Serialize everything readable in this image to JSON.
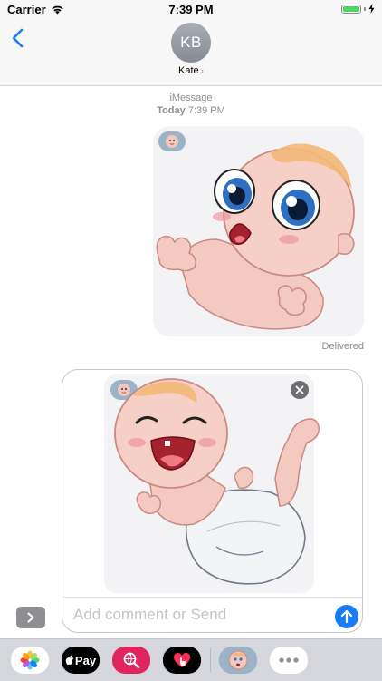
{
  "status_bar": {
    "carrier": "Carrier",
    "time": "7:39 PM",
    "battery_level": 1.0,
    "battery_color": "#4cd964"
  },
  "nav": {
    "back_icon": "chevron-left-icon",
    "accent_color": "#1a7cf5",
    "avatar_initials": "KB",
    "contact_name": "Kate",
    "contact_chevron": "›"
  },
  "conversation": {
    "service": "iMessage",
    "timestamp_day": "Today",
    "timestamp_time": "7:39 PM",
    "messages": [
      {
        "type": "sticker",
        "sticker": "crying-baby-sticker",
        "status": "Delivered"
      }
    ]
  },
  "compose": {
    "attachment_sticker": "laughing-baby-sticker",
    "remove_icon": "close-icon",
    "placeholder": "Add comment or Send",
    "value": "",
    "send_icon": "arrow-up-icon",
    "expand_icon": "chevron-right-icon"
  },
  "app_drawer": {
    "apps": [
      {
        "name": "photos-app-icon"
      },
      {
        "name": "apple-pay-app-icon",
        "label": "Pay"
      },
      {
        "name": "images-search-app-icon"
      },
      {
        "name": "digital-touch-app-icon"
      },
      {
        "name": "baby-sticker-app-icon"
      },
      {
        "name": "more-apps-icon"
      }
    ]
  }
}
